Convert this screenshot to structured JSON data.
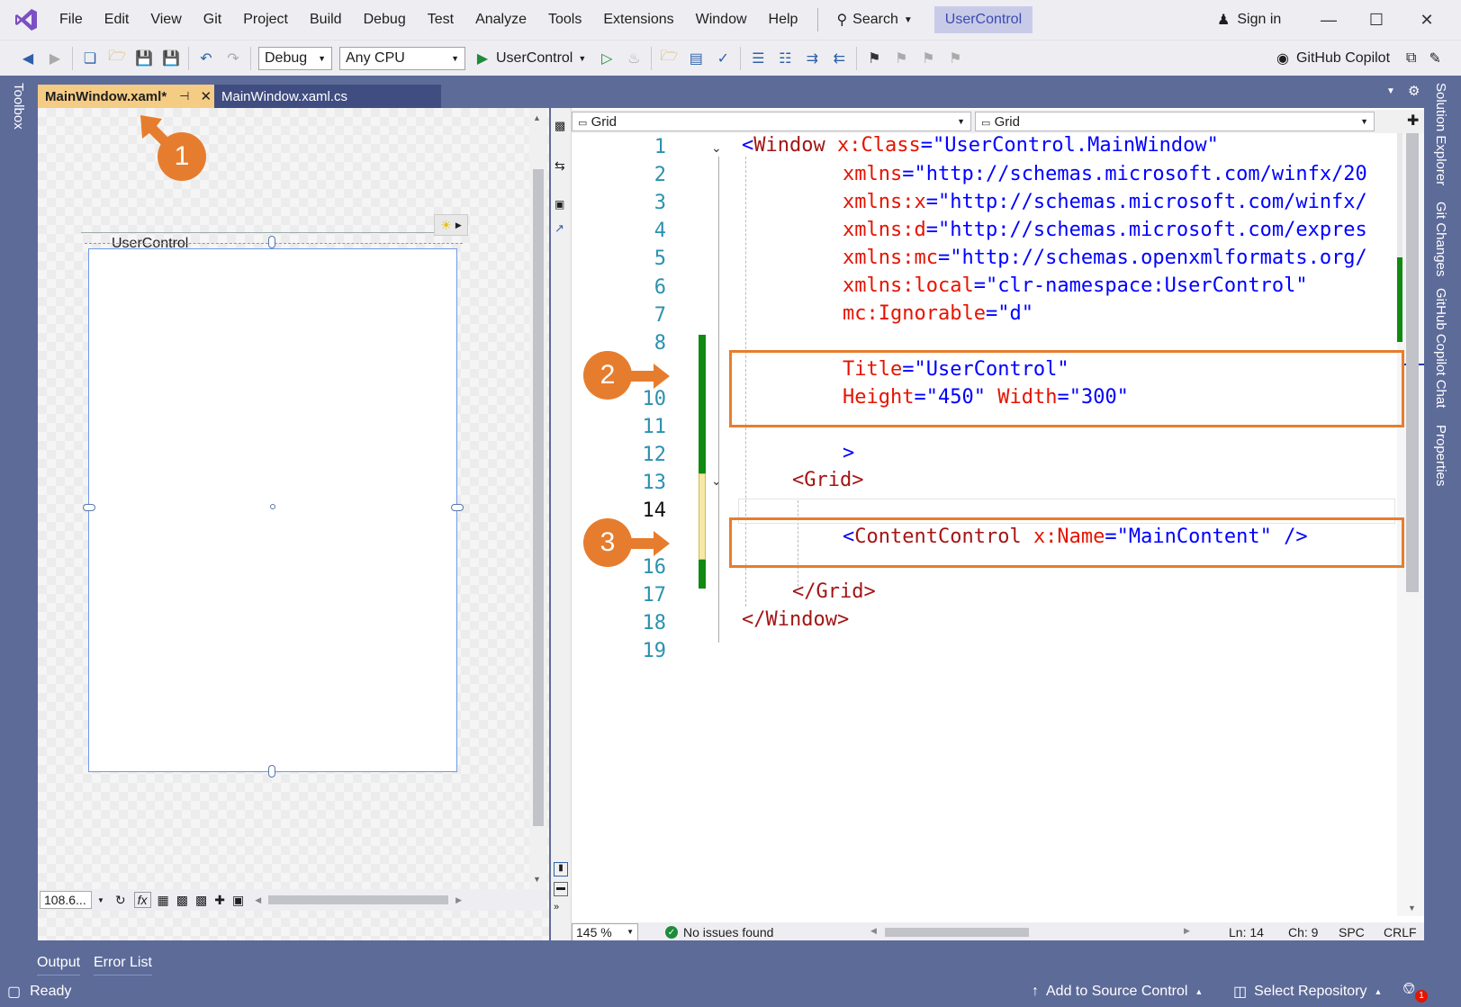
{
  "menu": {
    "items": [
      "File",
      "Edit",
      "View",
      "Git",
      "Project",
      "Build",
      "Debug",
      "Test",
      "Analyze",
      "Tools",
      "Extensions",
      "Window",
      "Help"
    ],
    "search_label": "Search",
    "title_pill": "UserControl",
    "sign_in": "Sign in"
  },
  "toolbar": {
    "config": "Debug",
    "platform": "Any CPU",
    "run_target": "UserControl",
    "copilot": "GitHub Copilot"
  },
  "side": {
    "toolbox": "Toolbox",
    "right": [
      "Solution Explorer",
      "Git Changes",
      "GitHub Copilot Chat",
      "Properties"
    ]
  },
  "tabs": [
    {
      "label": "MainWindow.xaml*"
    },
    {
      "label": "MainWindow.xaml.cs"
    }
  ],
  "designer": {
    "window_title": "UserControl",
    "zoom": "108.6...",
    "fx": "fx"
  },
  "editor": {
    "nav_left": "Grid",
    "nav_right": "Grid",
    "zoom": "145 %",
    "issues": "No issues found",
    "ln": "Ln: 14",
    "ch": "Ch: 9",
    "spc": "SPC",
    "crlf": "CRLF",
    "line_numbers": [
      "1",
      "2",
      "3",
      "4",
      "5",
      "6",
      "7",
      "8",
      "",
      "10",
      "11",
      "12",
      "13",
      "14",
      "",
      "16",
      "17",
      "18",
      "19"
    ]
  },
  "code": {
    "l1": {
      "open": "<",
      "tag": "Window",
      "attr": "x:Class",
      "eq": "=",
      "val": "\"UserControl.MainWindow\""
    },
    "l2": {
      "attr": "xmlns",
      "eq": "=",
      "val": "\"http://schemas.microsoft.com/winfx/20"
    },
    "l3": {
      "attr": "xmlns:x",
      "eq": "=",
      "val": "\"http://schemas.microsoft.com/winfx/"
    },
    "l4": {
      "attr": "xmlns:d",
      "eq": "=",
      "val": "\"http://schemas.microsoft.com/expres"
    },
    "l5": {
      "attr": "xmlns:mc",
      "eq": "=",
      "val": "\"http://schemas.openxmlformats.org/"
    },
    "l6": {
      "attr": "xmlns:local",
      "eq": "=",
      "val": "\"clr-namespace:UserControl\""
    },
    "l7": {
      "attr": "mc:Ignorable",
      "eq": "=",
      "val": "\"d\""
    },
    "l9": {
      "attr": "Title",
      "eq": "=",
      "val": "\"UserControl\""
    },
    "l10": {
      "attr1": "Height",
      "eq": "=",
      "val1": "\"450\"",
      "attr2": "Width",
      "val2": "\"300\""
    },
    "l12": {
      "close": ">"
    },
    "l13": {
      "text": "<Grid>"
    },
    "l15": {
      "open": "<",
      "tag": "ContentControl",
      "attr": "x:Name",
      "eq": "=",
      "val": "\"MainContent\"",
      "end": " />"
    },
    "l17": {
      "text": "</Grid>"
    },
    "l18": {
      "text": "</Window>"
    }
  },
  "bottom": {
    "tabs": [
      "Output",
      "Error List"
    ]
  },
  "status": {
    "ready": "Ready",
    "source_control": "Add to Source Control",
    "repository": "Select Repository",
    "notifications": "1"
  },
  "callouts": [
    "1",
    "2",
    "3"
  ],
  "colors": {
    "accent": "#e67d2e",
    "chrome": "#5d6b99",
    "active_tab": "#f5cc84"
  }
}
